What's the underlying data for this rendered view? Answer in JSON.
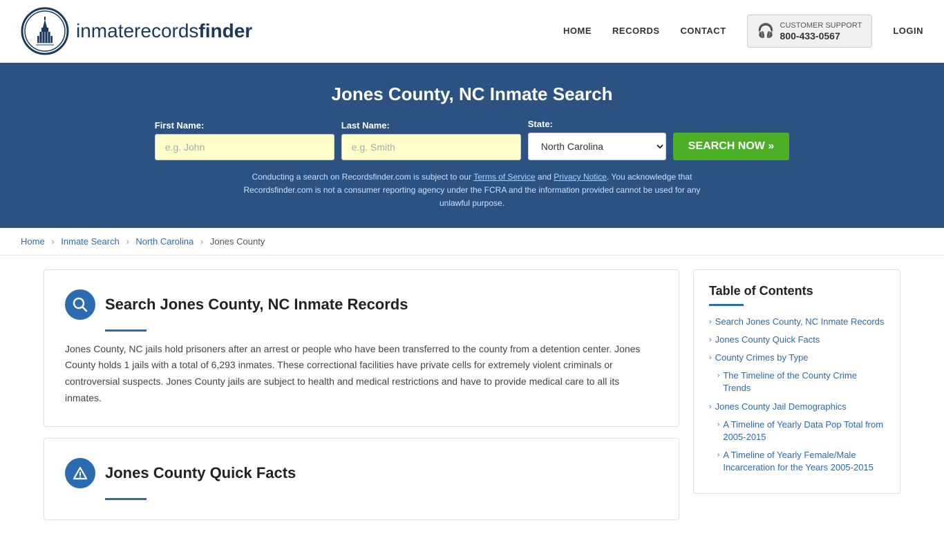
{
  "header": {
    "logo_text_normal": "inmaterecords",
    "logo_text_bold": "finder",
    "nav": {
      "home": "HOME",
      "records": "RECORDS",
      "contact": "CONTACT",
      "customer_support_label": "CUSTOMER SUPPORT",
      "customer_support_number": "800-433-0567",
      "login": "LOGIN"
    }
  },
  "hero": {
    "title": "Jones County, NC Inmate Search",
    "first_name_label": "First Name:",
    "first_name_placeholder": "e.g. John",
    "last_name_label": "Last Name:",
    "last_name_placeholder": "e.g. Smith",
    "state_label": "State:",
    "state_value": "North Carolina",
    "search_button": "SEARCH NOW »",
    "disclaimer": "Conducting a search on Recordsfinder.com is subject to our Terms of Service and Privacy Notice. You acknowledge that Recordsfinder.com is not a consumer reporting agency under the FCRA and the information provided cannot be used for any unlawful purpose.",
    "terms_link": "Terms of Service",
    "privacy_link": "Privacy Notice"
  },
  "breadcrumb": {
    "items": [
      "Home",
      "Inmate Search",
      "North Carolina",
      "Jones County"
    ]
  },
  "main": {
    "search_section": {
      "title": "Search Jones County, NC Inmate Records",
      "body": "Jones County, NC jails hold prisoners after an arrest or people who have been transferred to the county from a detention center. Jones County holds 1 jails with a total of 6,293 inmates. These correctional facilities have private cells for extremely violent criminals or controversial suspects. Jones County jails are subject to health and medical restrictions and have to provide medical care to all its inmates."
    },
    "quick_facts_section": {
      "title": "Jones County Quick Facts"
    }
  },
  "toc": {
    "title": "Table of Contents",
    "items": [
      {
        "label": "Search Jones County, NC Inmate Records",
        "sub": false
      },
      {
        "label": "Jones County Quick Facts",
        "sub": false
      },
      {
        "label": "County Crimes by Type",
        "sub": false
      },
      {
        "label": "The Timeline of the County Crime Trends",
        "sub": true
      },
      {
        "label": "Jones County Jail Demographics",
        "sub": false
      },
      {
        "label": "A Timeline of Yearly Data Pop Total from 2005-2015",
        "sub": true
      },
      {
        "label": "A Timeline of Yearly Female/Male Incarceration for the Years 2005-2015",
        "sub": true
      }
    ]
  }
}
